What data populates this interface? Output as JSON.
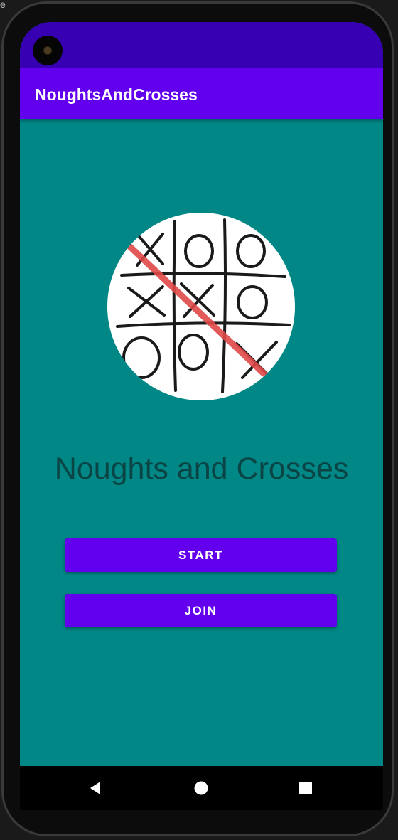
{
  "app_bar": {
    "title": "NoughtsAndCrosses"
  },
  "main": {
    "headline": "Noughts and Crosses",
    "start_label": "START",
    "join_label": "JOIN"
  },
  "nav": {
    "back_icon": "back-triangle-icon",
    "home_icon": "home-circle-icon",
    "recents_icon": "recents-square-icon"
  },
  "colors": {
    "status_bar": "#3700b3",
    "app_bar": "#6200ee",
    "background": "#008786",
    "headline": "#0b4444",
    "button": "#6200ee",
    "win_line": "#e04848"
  }
}
